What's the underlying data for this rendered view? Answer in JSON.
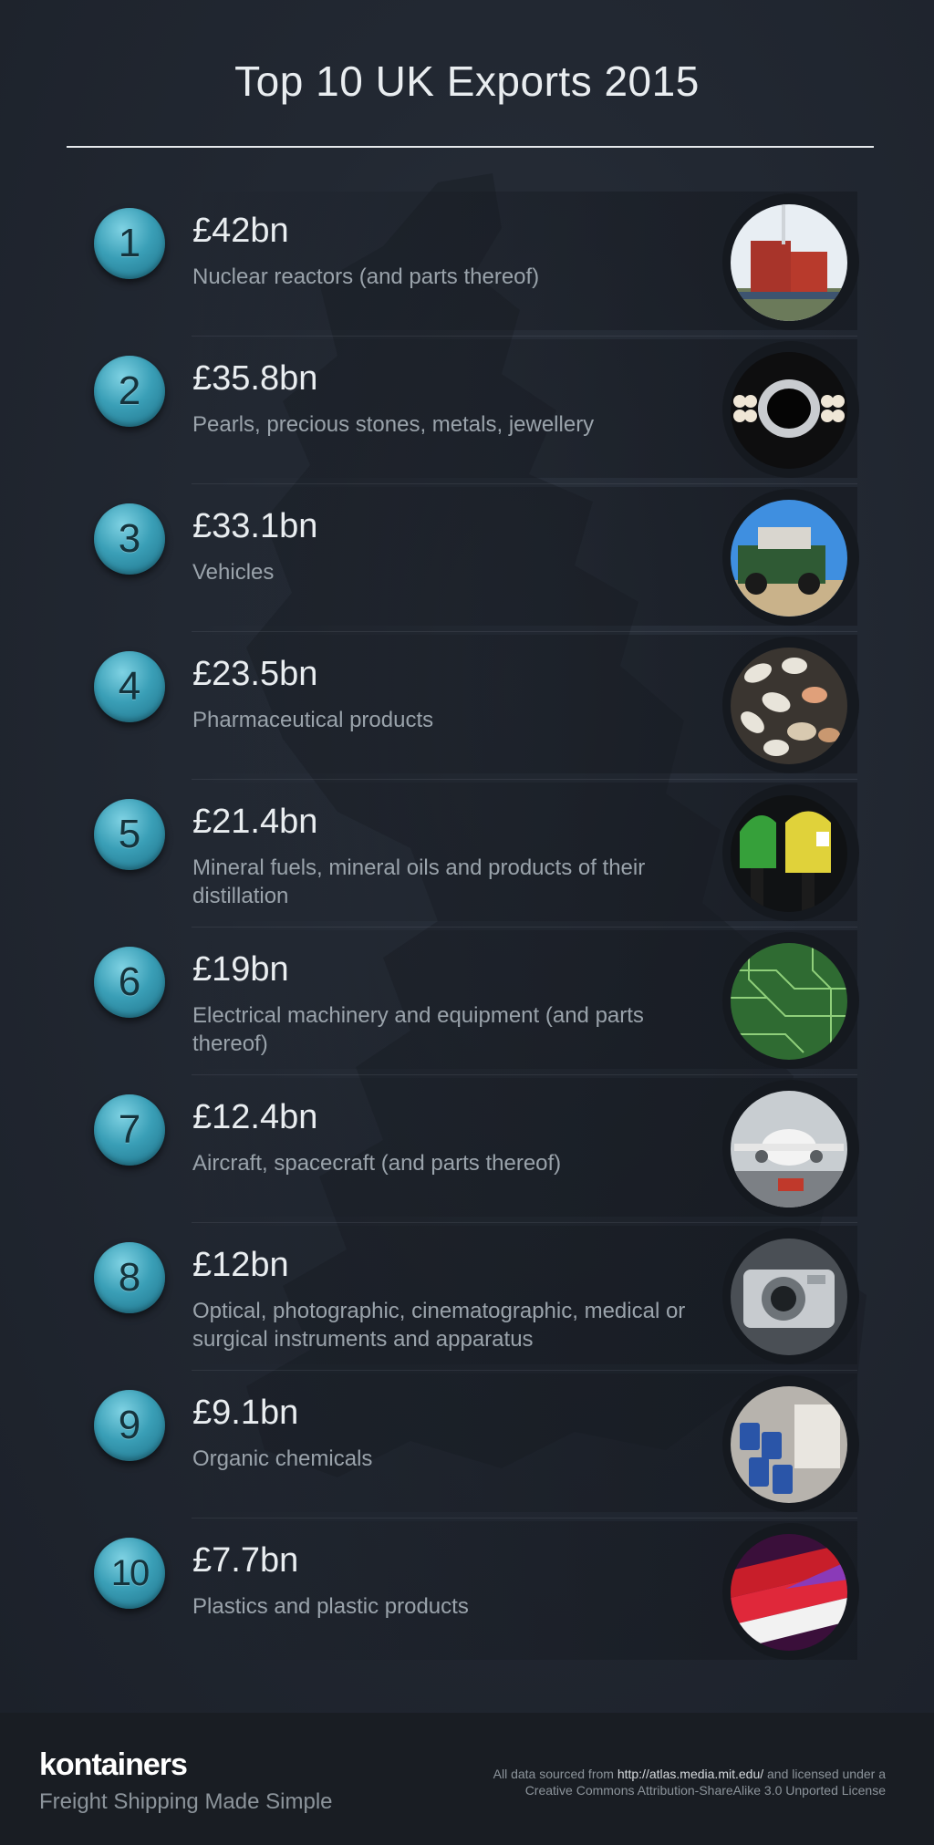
{
  "title": "Top 10 UK Exports 2015",
  "exports": [
    {
      "rank": "1",
      "value": "£42bn",
      "description": "Nuclear reactors (and parts thereof)",
      "image": "nuclear-power-plant-image"
    },
    {
      "rank": "2",
      "value": "£35.8bn",
      "description": "Pearls, precious stones, metals, jewellery",
      "image": "jewellery-brooch-image"
    },
    {
      "rank": "3",
      "value": "£33.1bn",
      "description": "Vehicles",
      "image": "land-rover-image"
    },
    {
      "rank": "4",
      "value": "£23.5bn",
      "description": "Pharmaceutical products",
      "image": "pills-image"
    },
    {
      "rank": "5",
      "value": "£21.4bn",
      "description": "Mineral fuels, mineral oils and products of their distillation",
      "image": "fuel-nozzles-image"
    },
    {
      "rank": "6",
      "value": "£19bn",
      "description": "Electrical machinery and equipment (and parts thereof)",
      "image": "circuit-board-image"
    },
    {
      "rank": "7",
      "value": "£12.4bn",
      "description": "Aircraft, spacecraft (and parts thereof)",
      "image": "aircraft-image"
    },
    {
      "rank": "8",
      "value": "£12bn",
      "description": "Optical, photographic, cinematographic, medical or surgical instruments and apparatus",
      "image": "camera-image"
    },
    {
      "rank": "9",
      "value": "£9.1bn",
      "description": "Organic chemicals",
      "image": "chemical-drums-image"
    },
    {
      "rank": "10",
      "value": "£7.7bn",
      "description": "Plastics and plastic products",
      "image": "plastic-items-image"
    }
  ],
  "footer": {
    "brand": "kontainers",
    "tagline": "Freight Shipping Made Simple",
    "source_prefix": "All data sourced from ",
    "source_link": "http://atlas.media.mit.edu/",
    "source_suffix": " and licensed under a",
    "license": "Creative Commons Attribution-ShareAlike 3.0 Unported License"
  },
  "colors": {
    "background": "#1f2530",
    "badge": "#3a9fb7",
    "footer": "#191d23"
  }
}
